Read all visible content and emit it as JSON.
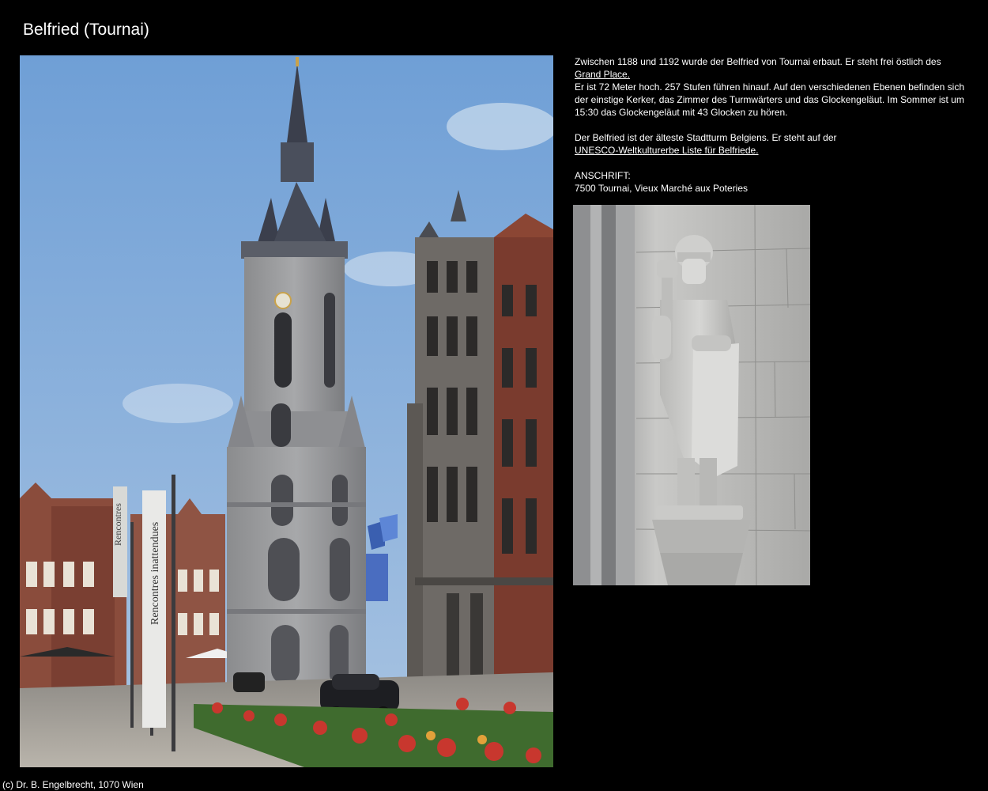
{
  "page": {
    "title": "Belfried (Tournai)"
  },
  "description": {
    "line1_prefix": "Zwischen 1188 und 1192 wurde der Belfried von Tournai erbaut. Er steht frei östlich des",
    "link_grand_place": "Grand Place.",
    "para1_rest": "Er ist 72 Meter hoch. 257 Stufen führen hinauf. Auf den verschiedenen Ebenen befinden sich der einstige Kerker, das Zimmer des Turmwärters und das Glockengeläut. Im Sommer ist um 15:30 das Glockengeläut mit 43 Glocken zu hören.",
    "para2_prefix": "Der Belfried ist der älteste Stadtturm Belgiens. Er steht auf der",
    "link_unesco": "UNESCO-Weltkulturerbe Liste für Belfriede.",
    "address_label": "ANSCHRIFT:",
    "address_value": "7500 Tournai, Vieux Marché aux Poteries"
  },
  "banners": {
    "banner1": "Rencontres",
    "banner2": "Rencontres inattendues"
  },
  "footer": {
    "copyright": "(c) Dr. B. Engelbrecht, 1070 Wien"
  },
  "colors": {
    "background": "#000000",
    "text": "#ffffff",
    "sky": "#7aa5d6",
    "stone": "#9a9a98"
  }
}
